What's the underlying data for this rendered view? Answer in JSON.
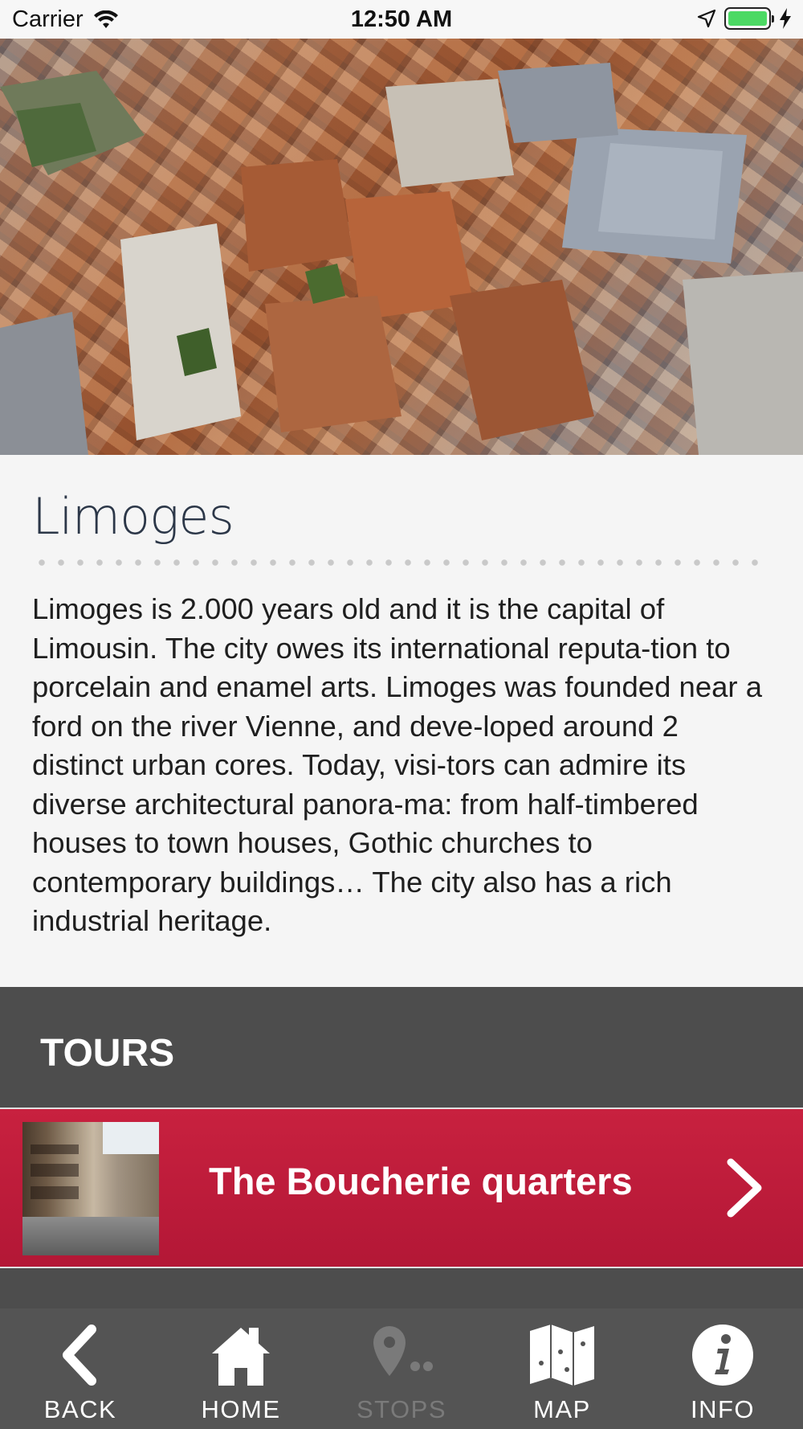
{
  "status_bar": {
    "carrier": "Carrier",
    "time": "12:50 AM",
    "battery_level": 1.0,
    "battery_color": "#4cd964"
  },
  "hero": {
    "icon": "aerial-city-photo"
  },
  "city": {
    "title": "Limoges",
    "description": "Limoges is 2.000 years old and it is the capital of Limousin. The city owes its international reputa-tion to porcelain and enamel arts. Limoges was founded near a ford on the river Vienne, and deve-loped around 2 distinct urban cores. Today, visi-tors can admire its diverse architectural panora-ma: from half-timbered houses to town houses, Gothic churches to contemporary buildings… The city also has a rich industrial heritage."
  },
  "tours": {
    "header": "TOURS",
    "items": [
      {
        "label": "The Boucherie quarters",
        "thumbnail_icon": "street-photo",
        "chevron_icon": "chevron-right-icon"
      }
    ]
  },
  "tab_bar": {
    "tabs": [
      {
        "label": "BACK",
        "icon": "back-arrow-icon",
        "enabled": true
      },
      {
        "label": "HOME",
        "icon": "home-icon",
        "enabled": true
      },
      {
        "label": "STOPS",
        "icon": "map-pin-icon",
        "enabled": false
      },
      {
        "label": "MAP",
        "icon": "folded-map-icon",
        "enabled": true
      },
      {
        "label": "INFO",
        "icon": "info-icon",
        "enabled": true
      }
    ]
  },
  "colors": {
    "accent_red": "#c11f3d",
    "dark_panel": "#4d4d4d",
    "title_navy": "#2c3748"
  }
}
